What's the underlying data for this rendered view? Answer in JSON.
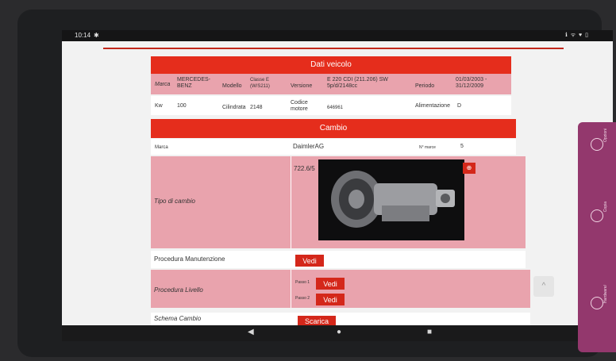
{
  "status_bar": {
    "time": "10:14",
    "gear_glyph": "✱",
    "sys_icons": "ℹ ᯤ ♥ ▯"
  },
  "dati_veicolo": {
    "title": "Dati veicolo",
    "row1": {
      "marca_label": "Marca",
      "marca_value": "MERCEDES-BENZ",
      "modello_label": "Modello",
      "modello_value": "Classe E (W/S211)",
      "versione_label": "Versione",
      "versione_value": "E 220 CDI (211.206) SW 5p/d/2148cc",
      "periodo_label": "Periodo",
      "periodo_value": "01/03/2003 - 31/12/2009"
    },
    "row2": {
      "kw_label": "Kw",
      "kw_value": "100",
      "cilindrata_label": "Cilindrata",
      "cilindrata_value": "2148",
      "codice_label": "Codice motore",
      "codice_value": "646961",
      "alimentazione_label": "Alimentazione",
      "alimentazione_value": "D"
    }
  },
  "cambio": {
    "title": "Cambio",
    "marca_label": "Marca",
    "marca_value": "DaimlerAG",
    "marce_label": "N° marce",
    "marce_value": "5",
    "tipo_label": "Tipo di cambio",
    "tipo_value": "722.6/5",
    "manutenzione_label": "Procedura Manutenzione",
    "manutenzione_button": "Vedi",
    "livello_label": "Procedura Livello",
    "passo1_label": "Passo 1",
    "passo1_button": "Vedi",
    "passo2_label": "Passo 2",
    "passo2_button": "Vedi",
    "schema_label": "Schema Cambio",
    "schema_button": "Scarica"
  },
  "side_panel": {
    "items": [
      "Opzioni",
      "Copia",
      "Hardware/"
    ]
  },
  "nav": {
    "back": "◀",
    "home": "●",
    "recent": "■"
  },
  "scroll_top_glyph": "^",
  "zoom_glyph": "⊕"
}
